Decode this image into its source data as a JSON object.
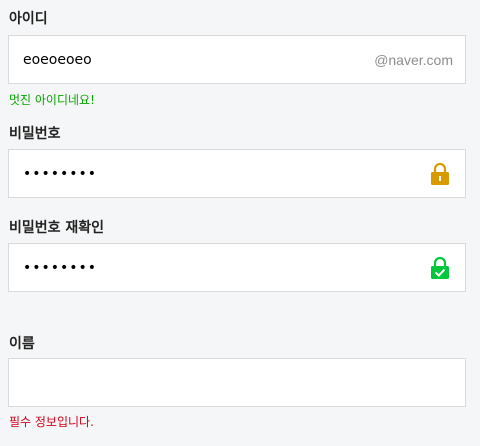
{
  "id_field": {
    "label": "아이디",
    "value": "eoeoeoeo",
    "suffix": "@naver.com",
    "message": "멋진 아이디네요!"
  },
  "password_field": {
    "label": "비밀번호",
    "value": "••••••••",
    "icon": "lock-icon",
    "icon_color": "#d79b00"
  },
  "password_confirm_field": {
    "label": "비밀번호 재확인",
    "value": "••••••••",
    "icon": "lock-check-icon",
    "icon_color": "#00c73c"
  },
  "name_field": {
    "label": "이름",
    "value": "",
    "message": "필수 정보입니다."
  },
  "colors": {
    "success": "#08a600",
    "error": "#d0021b",
    "border": "#dadada",
    "background": "#f5f6f7"
  }
}
